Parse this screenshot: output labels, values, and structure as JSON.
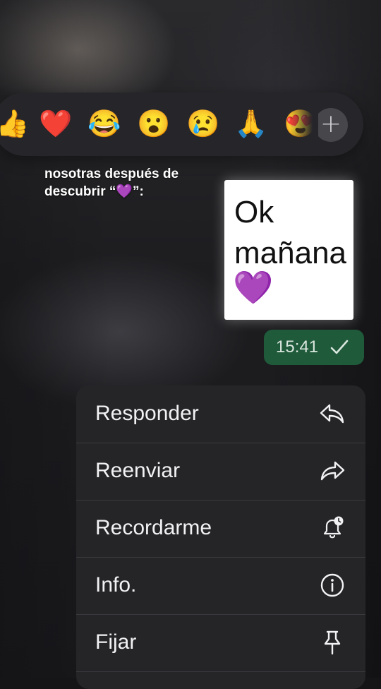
{
  "reactions": {
    "emojis": [
      "👍",
      "❤️",
      "😂",
      "😮",
      "😢",
      "🙏",
      "😍"
    ],
    "more_label": "+"
  },
  "message": {
    "caption": "nosotras después de descubrir “💜”:",
    "sticker": {
      "line1": "Ok",
      "line2": "mañana",
      "heart": "💜"
    },
    "time": "15:41"
  },
  "context_menu": {
    "items": [
      {
        "label": "Responder",
        "icon": "reply-icon"
      },
      {
        "label": "Reenviar",
        "icon": "forward-icon"
      },
      {
        "label": "Recordarme",
        "icon": "reminder-bell-icon"
      },
      {
        "label": "Info.",
        "icon": "info-icon"
      },
      {
        "label": "Fijar",
        "icon": "pin-icon"
      }
    ]
  },
  "colors": {
    "time_bubble": "#1f5a3b",
    "menu_background": "#252528",
    "reaction_bar": "#26262a"
  }
}
